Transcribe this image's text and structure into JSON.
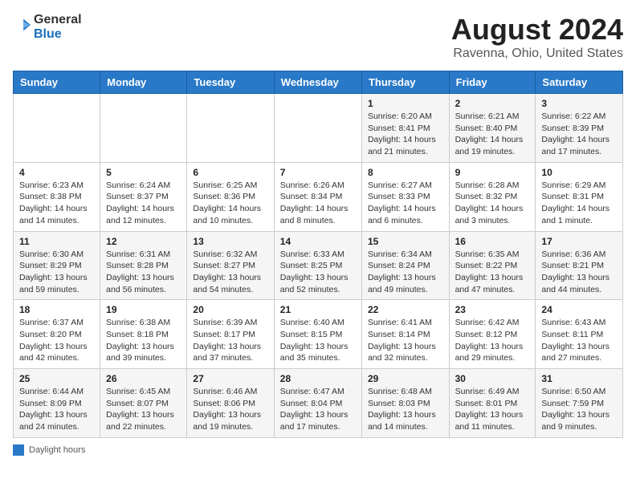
{
  "logo": {
    "general": "General",
    "blue": "Blue"
  },
  "title": "August 2024",
  "subtitle": "Ravenna, Ohio, United States",
  "days_of_week": [
    "Sunday",
    "Monday",
    "Tuesday",
    "Wednesday",
    "Thursday",
    "Friday",
    "Saturday"
  ],
  "legend_label": "Daylight hours",
  "weeks": [
    [
      {
        "day": "",
        "info": ""
      },
      {
        "day": "",
        "info": ""
      },
      {
        "day": "",
        "info": ""
      },
      {
        "day": "",
        "info": ""
      },
      {
        "day": "1",
        "info": "Sunrise: 6:20 AM\nSunset: 8:41 PM\nDaylight: 14 hours and 21 minutes."
      },
      {
        "day": "2",
        "info": "Sunrise: 6:21 AM\nSunset: 8:40 PM\nDaylight: 14 hours and 19 minutes."
      },
      {
        "day": "3",
        "info": "Sunrise: 6:22 AM\nSunset: 8:39 PM\nDaylight: 14 hours and 17 minutes."
      }
    ],
    [
      {
        "day": "4",
        "info": "Sunrise: 6:23 AM\nSunset: 8:38 PM\nDaylight: 14 hours and 14 minutes."
      },
      {
        "day": "5",
        "info": "Sunrise: 6:24 AM\nSunset: 8:37 PM\nDaylight: 14 hours and 12 minutes."
      },
      {
        "day": "6",
        "info": "Sunrise: 6:25 AM\nSunset: 8:36 PM\nDaylight: 14 hours and 10 minutes."
      },
      {
        "day": "7",
        "info": "Sunrise: 6:26 AM\nSunset: 8:34 PM\nDaylight: 14 hours and 8 minutes."
      },
      {
        "day": "8",
        "info": "Sunrise: 6:27 AM\nSunset: 8:33 PM\nDaylight: 14 hours and 6 minutes."
      },
      {
        "day": "9",
        "info": "Sunrise: 6:28 AM\nSunset: 8:32 PM\nDaylight: 14 hours and 3 minutes."
      },
      {
        "day": "10",
        "info": "Sunrise: 6:29 AM\nSunset: 8:31 PM\nDaylight: 14 hours and 1 minute."
      }
    ],
    [
      {
        "day": "11",
        "info": "Sunrise: 6:30 AM\nSunset: 8:29 PM\nDaylight: 13 hours and 59 minutes."
      },
      {
        "day": "12",
        "info": "Sunrise: 6:31 AM\nSunset: 8:28 PM\nDaylight: 13 hours and 56 minutes."
      },
      {
        "day": "13",
        "info": "Sunrise: 6:32 AM\nSunset: 8:27 PM\nDaylight: 13 hours and 54 minutes."
      },
      {
        "day": "14",
        "info": "Sunrise: 6:33 AM\nSunset: 8:25 PM\nDaylight: 13 hours and 52 minutes."
      },
      {
        "day": "15",
        "info": "Sunrise: 6:34 AM\nSunset: 8:24 PM\nDaylight: 13 hours and 49 minutes."
      },
      {
        "day": "16",
        "info": "Sunrise: 6:35 AM\nSunset: 8:22 PM\nDaylight: 13 hours and 47 minutes."
      },
      {
        "day": "17",
        "info": "Sunrise: 6:36 AM\nSunset: 8:21 PM\nDaylight: 13 hours and 44 minutes."
      }
    ],
    [
      {
        "day": "18",
        "info": "Sunrise: 6:37 AM\nSunset: 8:20 PM\nDaylight: 13 hours and 42 minutes."
      },
      {
        "day": "19",
        "info": "Sunrise: 6:38 AM\nSunset: 8:18 PM\nDaylight: 13 hours and 39 minutes."
      },
      {
        "day": "20",
        "info": "Sunrise: 6:39 AM\nSunset: 8:17 PM\nDaylight: 13 hours and 37 minutes."
      },
      {
        "day": "21",
        "info": "Sunrise: 6:40 AM\nSunset: 8:15 PM\nDaylight: 13 hours and 35 minutes."
      },
      {
        "day": "22",
        "info": "Sunrise: 6:41 AM\nSunset: 8:14 PM\nDaylight: 13 hours and 32 minutes."
      },
      {
        "day": "23",
        "info": "Sunrise: 6:42 AM\nSunset: 8:12 PM\nDaylight: 13 hours and 29 minutes."
      },
      {
        "day": "24",
        "info": "Sunrise: 6:43 AM\nSunset: 8:11 PM\nDaylight: 13 hours and 27 minutes."
      }
    ],
    [
      {
        "day": "25",
        "info": "Sunrise: 6:44 AM\nSunset: 8:09 PM\nDaylight: 13 hours and 24 minutes."
      },
      {
        "day": "26",
        "info": "Sunrise: 6:45 AM\nSunset: 8:07 PM\nDaylight: 13 hours and 22 minutes."
      },
      {
        "day": "27",
        "info": "Sunrise: 6:46 AM\nSunset: 8:06 PM\nDaylight: 13 hours and 19 minutes."
      },
      {
        "day": "28",
        "info": "Sunrise: 6:47 AM\nSunset: 8:04 PM\nDaylight: 13 hours and 17 minutes."
      },
      {
        "day": "29",
        "info": "Sunrise: 6:48 AM\nSunset: 8:03 PM\nDaylight: 13 hours and 14 minutes."
      },
      {
        "day": "30",
        "info": "Sunrise: 6:49 AM\nSunset: 8:01 PM\nDaylight: 13 hours and 11 minutes."
      },
      {
        "day": "31",
        "info": "Sunrise: 6:50 AM\nSunset: 7:59 PM\nDaylight: 13 hours and 9 minutes."
      }
    ]
  ]
}
